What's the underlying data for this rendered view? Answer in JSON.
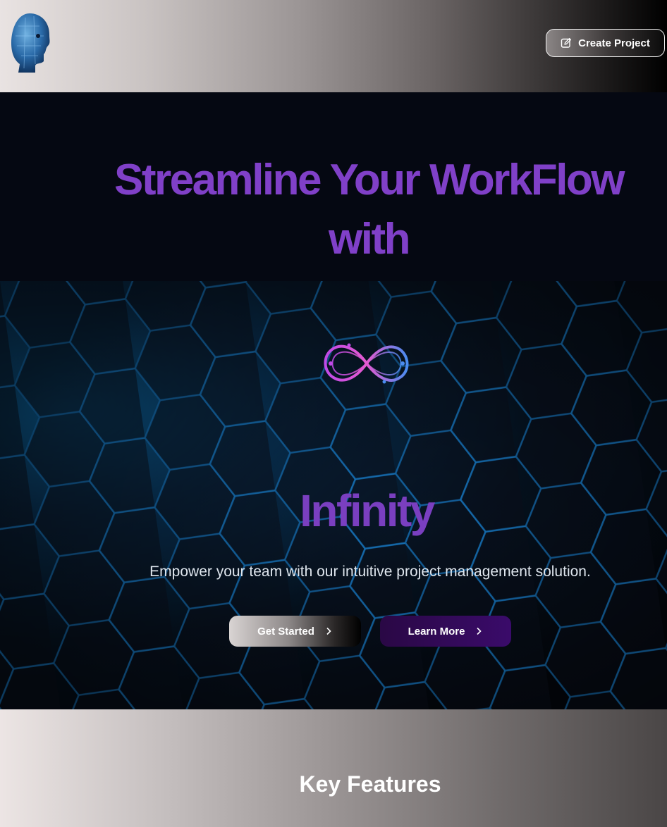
{
  "header": {
    "create_project_label": "Create Project",
    "logo_icon": "robot-head-icon",
    "create_icon": "edit-square-icon"
  },
  "hero": {
    "headline_line1": "Streamline Your WorkFlow",
    "headline_line2": "with",
    "brand_name": "Infinity",
    "brand_icon": "infinity-circuit-icon",
    "tagline": "Empower your team with our intuitive project management solution.",
    "get_started_label": "Get Started",
    "learn_more_label": "Learn More",
    "chevron_icon": "chevron-right-icon"
  },
  "features": {
    "title": "Key Features"
  },
  "colors": {
    "headline": "#8040c8",
    "brand": "#7a3fc0",
    "hero_background": "#050812",
    "learn_more_button": "#3a0b6a",
    "accent_glow": "#1aa0ff"
  }
}
